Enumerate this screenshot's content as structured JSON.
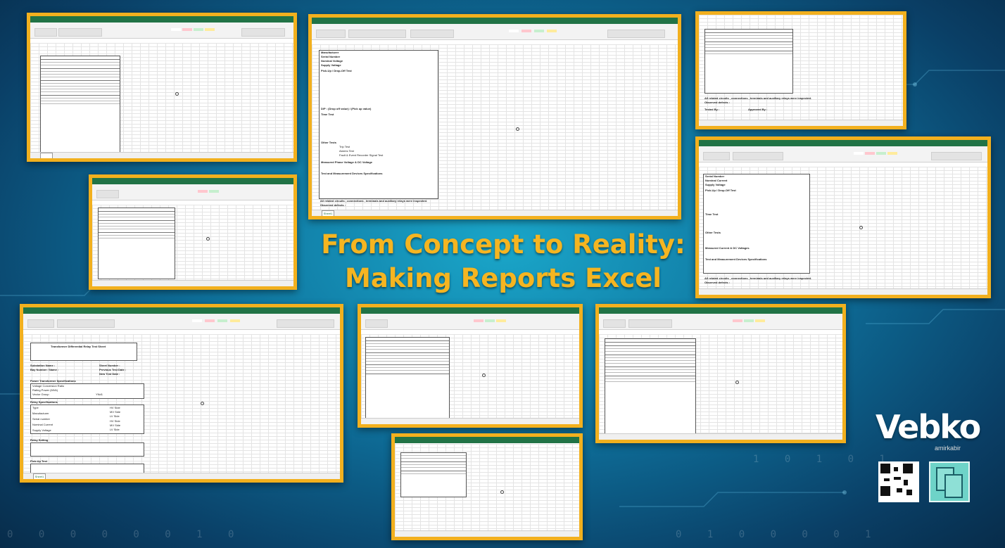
{
  "headline": {
    "line1": "From Concept to Reality:",
    "line2": "Making Reports Excel"
  },
  "brand": {
    "logo_text": "Vebko",
    "logo_sub": "amirkabir"
  },
  "colors": {
    "frame_border": "#f2b01e",
    "headline": "#f5b521",
    "excel_green": "#217346"
  },
  "icons": [
    "qr-code-icon",
    "copy-documents-icon"
  ],
  "screenshots": {
    "top_center": {
      "rows": [
        "Manufacturer",
        "Serial Number",
        "Nominal Voltage",
        "Supply Voltage",
        "Pick-Up / Drop-Off Test",
        "D/P : (Drop off value) / (Pick up value)",
        "Time Test",
        "Other Tests",
        "Measured Phase Voltage & DC Voltage",
        "Test and Measurement Devices Specifications"
      ],
      "other_tests": [
        "Trip Test",
        "Alarms Test",
        "Fault & Event Recorder Signal Test"
      ],
      "footer_lines": [
        "All related circuits , connections , terminals and auxiliary relays were inspected.",
        "Observed defects :"
      ],
      "sheet_tab": "Sheet1"
    },
    "bottom_left": {
      "title": "Transformer Differential Relay Test Sheet",
      "fields": [
        "Substation Name :",
        "Bay Number / Name :",
        "Sheet Number :",
        "Previous Test Date :",
        "New Test Date :"
      ],
      "sections": [
        "Power Transformer Specifications",
        "Relay Specifications",
        "Relay Setting",
        "Pick-Up Test"
      ],
      "spec_rows": [
        "Voltage Conversion Ratio",
        "Rating Power (MVA)",
        "Vector Group"
      ],
      "relay_rows": [
        "Type",
        "Manufacturer",
        "Serial number",
        "Nominal Current",
        "Supply Voltage"
      ],
      "side_labels": [
        "HV Side",
        "MV Side",
        "LV Side",
        "HV Side",
        "MV Side",
        "LV Side"
      ],
      "vector_value": "YNd1",
      "sheet_tab": "Sheet1"
    },
    "right_middle": {
      "rows": [
        "Serial Number",
        "Nominal Current",
        "Supply Voltage",
        "Pick-Up / Drop-Off Test",
        "Time Test",
        "Other Tests",
        "Measured Current & DC Voltages",
        "Test and Measurement Devices Specifications"
      ],
      "footer_lines": [
        "All related circuits , connections , terminals and auxiliary relays were inspected.",
        "Observed defects :"
      ],
      "signatures": [
        "Tested By :",
        "Approved By :"
      ]
    },
    "right_top": {
      "footer_lines": [
        "All related circuits , connections , terminals and auxiliary relays were inspected.",
        "Observed defects :"
      ],
      "signatures": [
        "Tested By :",
        "Approved By :"
      ]
    }
  }
}
